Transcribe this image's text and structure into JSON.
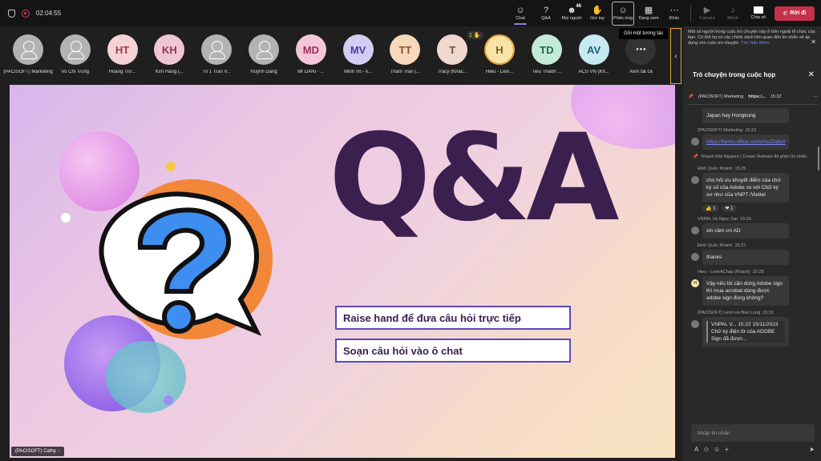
{
  "topbar": {
    "timer": "02:04:55",
    "tools": [
      {
        "label": "Chat",
        "icon": "☺"
      },
      {
        "label": "Q&A",
        "icon": "?"
      },
      {
        "label": "Mọi người",
        "icon": "☻",
        "badge": "46"
      },
      {
        "label": "Giơ tay",
        "icon": "✋"
      },
      {
        "label": "Phản ứng",
        "icon": "☺"
      },
      {
        "label": "Dạng xem",
        "icon": "▦"
      },
      {
        "label": "Khác",
        "icon": "⋯"
      },
      {
        "label": "Camera",
        "icon": "▶"
      },
      {
        "label": "Micrô",
        "icon": "♪"
      },
      {
        "label": "Chia sẻ",
        "icon": "↑"
      }
    ],
    "leave_label": "Rời đi",
    "tooltip": "Gửi một tương tác"
  },
  "participants": [
    {
      "name": "(PACISOFT) Marketing",
      "initials": "",
      "bg": "#b3b3b3",
      "fg": "#fff"
    },
    {
      "name": "Vo Chi Trung",
      "initials": "",
      "bg": "#b3b3b3",
      "fg": "#fff"
    },
    {
      "name": "Hoàng Trư...",
      "initials": "HT",
      "bg": "#f4d2d6",
      "fg": "#a33b4a"
    },
    {
      "name": "Kim Hằng (...",
      "initials": "KH",
      "bg": "#f1c6d3",
      "fg": "#8d3552"
    },
    {
      "name": "Tri 1 Tran V...",
      "initials": "",
      "bg": "#b3b3b3",
      "fg": "#fff"
    },
    {
      "name": "Huynh Dang",
      "initials": "",
      "bg": "#b3b3b3",
      "fg": "#fff"
    },
    {
      "name": "Mr DANI - ...",
      "initials": "MD",
      "bg": "#f3c7d8",
      "fg": "#9c3060"
    },
    {
      "name": "Minh Vo - k...",
      "initials": "MV",
      "bg": "#d4cdf3",
      "fg": "#4b3f9a"
    },
    {
      "name": "Tham Tran (...",
      "initials": "TT",
      "bg": "#f7d8bd",
      "fg": "#8a5424"
    },
    {
      "name": "Tracy (Khác...",
      "initials": "T",
      "bg": "#f0d8cd",
      "fg": "#7c4c38"
    },
    {
      "name": "Hieu - Lien...",
      "initials": "H",
      "bg": "#f7e4a6",
      "fg": "#7a5d12",
      "hand": "1 ✋"
    },
    {
      "name": "Tieu Thanh ...",
      "initials": "TD",
      "bg": "#c4ead9",
      "fg": "#1c6b4c"
    },
    {
      "name": "ACS VN (Kh...",
      "initials": "AV",
      "bg": "#c8e9f0",
      "fg": "#166276"
    },
    {
      "name": "Xem tất cả",
      "initials": "⋯",
      "bg": "#333",
      "fg": "#ddd"
    }
  ],
  "slide": {
    "title": "Q&A",
    "line1": "Raise hand để đưa câu hỏi trực tiếp",
    "line2": "Soạn câu hỏi vào ô chat",
    "presenter": "(PACISOFT) Cathy"
  },
  "chat": {
    "banner": "Một số người trong cuộc trò chuyện này ở bên ngoài tổ chức của bạn. Có thể họ có các chính sách liên quan đến tin nhắn sẽ áp dụng cho cuộc trò chuyện.",
    "banner_link": "Tìm hiểu thêm",
    "title": "Trò chuyện trong cuộc họp",
    "pinned_author": "(PACISOFT) Marketing",
    "pinned_snippet": "https:/...",
    "pinned_time": "15:22",
    "composer_placeholder": "Nhập tin nhắn",
    "messages": [
      {
        "type": "bubble",
        "author": "",
        "time": "",
        "text": "Japan hay Hongkong",
        "partial": true
      },
      {
        "type": "bubble",
        "author": "(PACISOFT) Marketing",
        "time": "15:22",
        "text": "https://forms.office.com/r/ssZtidix0",
        "link": true
      },
      {
        "type": "sys",
        "text": "Khanh Mai Nguyen | Crowe Vietnam đã ghim tin nhắn."
      },
      {
        "type": "bubble",
        "author": "Đinh Quốc Khánh",
        "time": "15:25",
        "text": "cho hỏi ưu khuyết điểm của chữ ký số của Adobe so với Chữ ký sơ như của VNPT /Viettel",
        "reactions": [
          "👍 1",
          "❤ 1"
        ]
      },
      {
        "type": "bubble",
        "author": "VNPAL Vo Ngoc Tan",
        "time": "15:26",
        "text": "xin cảm ơn AD"
      },
      {
        "type": "bubble",
        "author": "Đinh Quốc Khánh",
        "time": "15:27",
        "text": "thanks"
      },
      {
        "type": "bubble",
        "author": "Hieu - LiemAChau (Khách)",
        "time": "15:28",
        "text": "Vậy nếu tôi cần dùng Adobe sign thì mua acrobat dùng được adobe sign đúng không?",
        "initial": "H"
      },
      {
        "type": "bubble",
        "author": "(PACISOFT) Lenh Ha Bao Long",
        "time": "15:31",
        "text": "Chữ ký điện tử của ADOBE Sign đã được...",
        "quote": "VNPAL V... 15:22 15/11/2023"
      }
    ]
  }
}
